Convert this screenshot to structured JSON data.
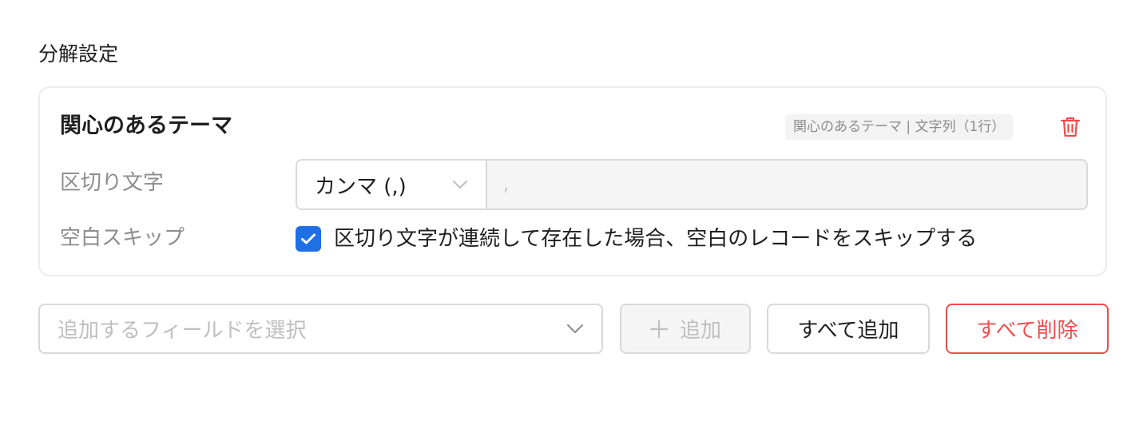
{
  "section": {
    "title": "分解設定"
  },
  "card": {
    "title": "関心のあるテーマ",
    "field_tag": "関心のあるテーマ | 文字列（1行）",
    "delimiter": {
      "label": "区切り文字",
      "selected": "カンマ (,)",
      "value": ","
    },
    "skip_blank": {
      "label": "空白スキップ",
      "checked": true,
      "text": "区切り文字が連続して存在した場合、空白のレコードをスキップする"
    }
  },
  "actions": {
    "field_select_placeholder": "追加するフィールドを選択",
    "add_label": "追加",
    "add_all_label": "すべて追加",
    "delete_all_label": "すべて削除"
  },
  "colors": {
    "primary": "#1f6fe5",
    "danger": "#ef4d4d",
    "border": "#d9d9d9",
    "muted_text": "#8c8c8c",
    "placeholder": "#bfbfbf"
  },
  "icons": {
    "trash": "trash-icon",
    "chevron": "chevron-down-icon",
    "check": "check-icon",
    "plus": "plus-icon"
  }
}
